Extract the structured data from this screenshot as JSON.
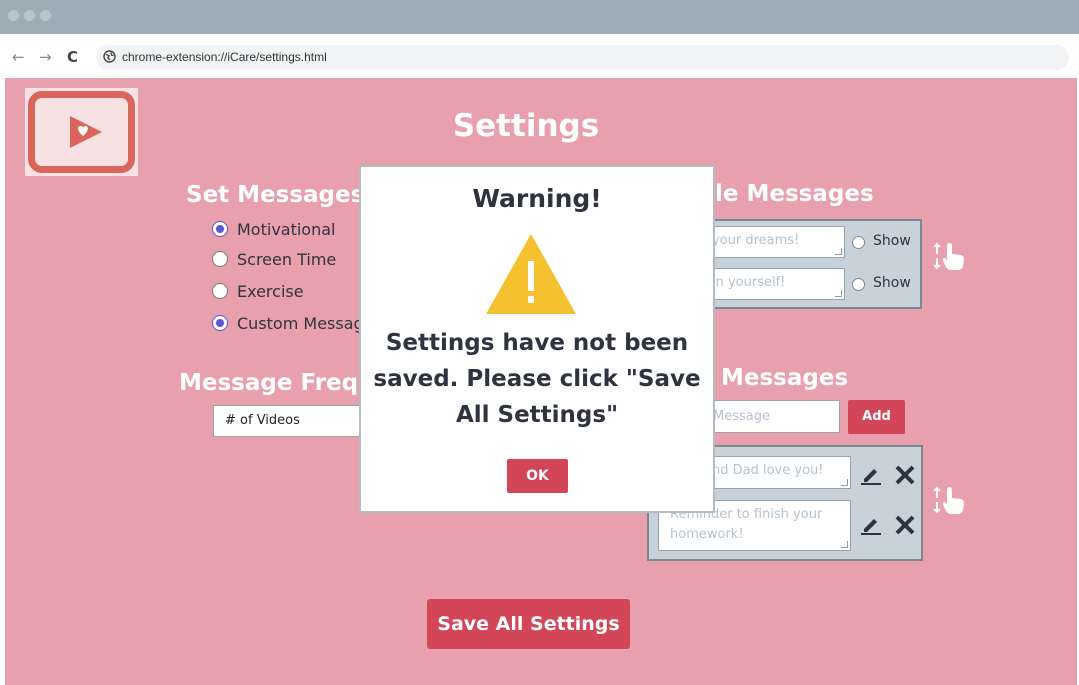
{
  "browser": {
    "url": "chrome-extension://iCare/settings.html",
    "back_icon": "←",
    "forward_icon": "→",
    "reload_icon": "C"
  },
  "page": {
    "title": "Settings"
  },
  "set_messages": {
    "heading": "Set Messages",
    "options": [
      {
        "label": "Motivational",
        "checked": true
      },
      {
        "label": "Screen Time",
        "checked": false
      },
      {
        "label": "Exercise",
        "checked": false
      },
      {
        "label": "Custom Messag",
        "checked": true
      }
    ]
  },
  "frequency": {
    "heading": "Message Frequ",
    "selected": "# of Videos"
  },
  "sample_messages": {
    "heading": "le Messages",
    "items": [
      {
        "text": "your dreams!",
        "show_label": "Show"
      },
      {
        "text": "in yourself!",
        "show_label": "Show"
      }
    ]
  },
  "custom_messages": {
    "heading": "Messages",
    "input_placeholder": "Message",
    "add_label": "Add",
    "items": [
      {
        "text": "nd Dad love you!"
      },
      {
        "text": "Reminder to finish your homework!"
      }
    ]
  },
  "save_button": {
    "label": "Save All Settings"
  },
  "modal": {
    "title": "Warning!",
    "message": "Settings have not been saved. Please click \"Save All Settings\"",
    "ok_label": "OK"
  },
  "colors": {
    "background": "#e8a1ac",
    "accent_red": "#d34558",
    "panel": "#c7d2db",
    "warning_yellow": "#f5c12e",
    "radio_checked": "#5b55e0"
  },
  "icons": {
    "logo": "play-heart-icon",
    "warning": "warning-triangle-icon",
    "edit": "pencil-icon",
    "delete": "close-icon",
    "reorder": "drag-hand-icon"
  }
}
